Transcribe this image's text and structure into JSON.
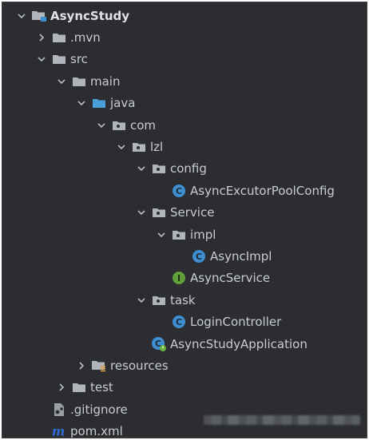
{
  "tree": [
    {
      "label": "AsyncStudy",
      "depth": 0,
      "expanded": true,
      "icon": "module-folder-icon",
      "bold": true
    },
    {
      "label": ".mvn",
      "depth": 1,
      "expanded": false,
      "icon": "folder-icon"
    },
    {
      "label": "src",
      "depth": 1,
      "expanded": true,
      "icon": "folder-icon"
    },
    {
      "label": "main",
      "depth": 2,
      "expanded": true,
      "icon": "folder-icon"
    },
    {
      "label": "java",
      "depth": 3,
      "expanded": true,
      "icon": "source-folder-icon"
    },
    {
      "label": "com",
      "depth": 4,
      "expanded": true,
      "icon": "package-icon"
    },
    {
      "label": "lzl",
      "depth": 5,
      "expanded": true,
      "icon": "package-icon"
    },
    {
      "label": "config",
      "depth": 6,
      "expanded": true,
      "icon": "package-icon"
    },
    {
      "label": "AsyncExcutorPoolConfig",
      "depth": 7,
      "expanded": null,
      "icon": "class-icon"
    },
    {
      "label": "Service",
      "depth": 6,
      "expanded": true,
      "icon": "package-icon"
    },
    {
      "label": "impl",
      "depth": 7,
      "expanded": true,
      "icon": "package-icon"
    },
    {
      "label": "AsyncImpl",
      "depth": 8,
      "expanded": null,
      "icon": "class-icon"
    },
    {
      "label": "AsyncService",
      "depth": 7,
      "expanded": null,
      "icon": "interface-icon"
    },
    {
      "label": "task",
      "depth": 6,
      "expanded": true,
      "icon": "package-icon"
    },
    {
      "label": "LoginController",
      "depth": 7,
      "expanded": null,
      "icon": "class-icon"
    },
    {
      "label": "AsyncStudyApplication",
      "depth": 6,
      "expanded": null,
      "icon": "spring-boot-class-icon"
    },
    {
      "label": "resources",
      "depth": 3,
      "expanded": false,
      "icon": "resources-folder-icon"
    },
    {
      "label": "test",
      "depth": 2,
      "expanded": false,
      "icon": "folder-icon"
    },
    {
      "label": ".gitignore",
      "depth": 1,
      "expanded": null,
      "icon": "gitignore-file-icon"
    },
    {
      "label": "pom.xml",
      "depth": 1,
      "expanded": null,
      "icon": "maven-pom-icon"
    }
  ],
  "colors": {
    "background": "#2b2d30",
    "text": "#c9ccd1",
    "folder": "#b1b5bb",
    "source_folder": "#4a9fd8",
    "class_badge": "#3d8fd1",
    "interface_badge": "#5f9e3a",
    "maven": "#2d6bd6"
  }
}
